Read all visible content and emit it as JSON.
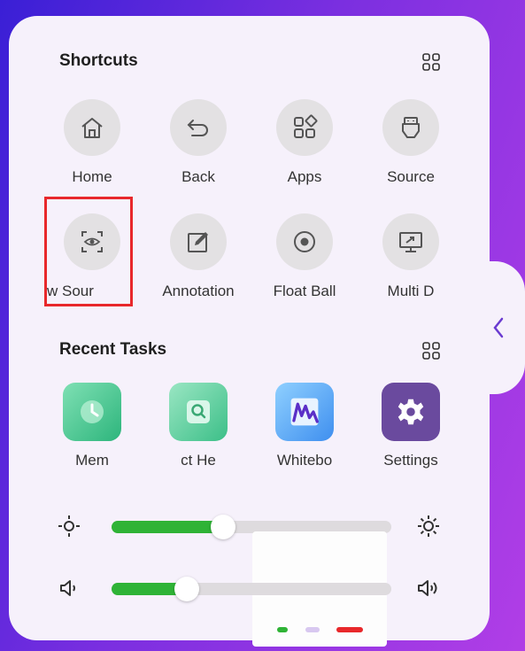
{
  "shortcuts": {
    "title": "Shortcuts",
    "items": [
      {
        "label": "Home",
        "icon": "home-icon"
      },
      {
        "label": "Back",
        "icon": "back-icon"
      },
      {
        "label": "Apps",
        "icon": "apps-icon"
      },
      {
        "label": "Source",
        "icon": "source-icon"
      },
      {
        "label": "w    Sour",
        "icon": "eye-scan-icon"
      },
      {
        "label": "Annotation",
        "icon": "annotation-icon"
      },
      {
        "label": "Float Ball",
        "icon": "float-ball-icon"
      },
      {
        "label": "Multi D",
        "icon": "multi-display-icon"
      }
    ]
  },
  "recent_tasks": {
    "title": "Recent Tasks",
    "apps": [
      {
        "label": "Mem",
        "icon": "memory-app-icon"
      },
      {
        "label": "ct   He",
        "icon": "search-app-icon"
      },
      {
        "label": "Whitebo",
        "icon": "whiteboard-app-icon"
      },
      {
        "label": "Settings",
        "icon": "settings-app-icon"
      }
    ]
  },
  "brightness": {
    "value_percent": 40
  },
  "volume": {
    "value_percent": 27
  },
  "colors": {
    "panel": "#f6f1fb",
    "slider_fill": "#2fb336",
    "highlight": "#e8282b",
    "settings_tile": "#6a4a9e"
  }
}
